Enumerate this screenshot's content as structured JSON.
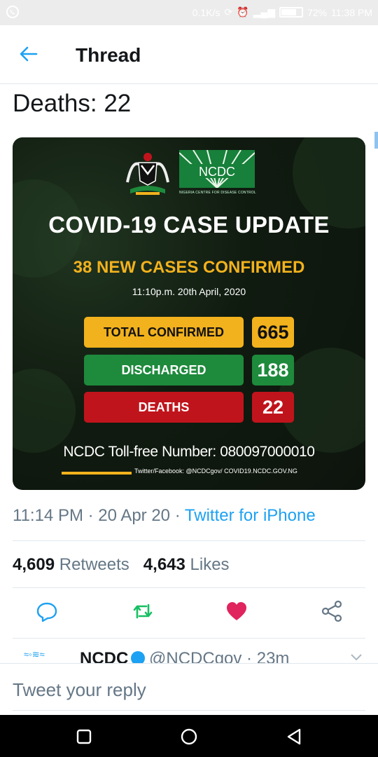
{
  "status_bar": {
    "speed": "0.1K/s",
    "battery": "72%",
    "time": "11:38 PM",
    "battery_level": 0.72
  },
  "header": {
    "title": "Thread"
  },
  "tweet": {
    "text_tail": "Deaths: 22",
    "timestamp": "11:14 PM · 20 Apr 20 · ",
    "source": "Twitter for iPhone",
    "retweets_count": "4,609",
    "retweets_label": "Retweets",
    "likes_count": "4,643",
    "likes_label": "Likes"
  },
  "media": {
    "org_name": "NCDC",
    "org_subtitle": "NIGERIA CENTRE FOR DISEASE CONTROL",
    "headline": "COVID-19 CASE UPDATE",
    "new_cases": "38 NEW CASES CONFIRMED",
    "datetime": "11:10p.m. 20th April, 2020",
    "stats": [
      {
        "label": "TOTAL CONFIRMED",
        "value": "665"
      },
      {
        "label": "DISCHARGED",
        "value": "188"
      },
      {
        "label": "DEATHS",
        "value": "22"
      }
    ],
    "tollfree": "NCDC Toll-free Number: 080097000010",
    "socials": "Twitter/Facebook: @NCDCgov/ COVID19.NCDC.GOV.NG"
  },
  "reply_preview": {
    "name": "NCDC",
    "handle": "@NCDCgov · 23m"
  },
  "reply_box": {
    "placeholder": "Tweet your reply"
  },
  "colors": {
    "accent": "#1da1f2",
    "retweet": "#17bf63",
    "like": "#e0245e",
    "yellow": "#f2b21d",
    "green": "#1e8a3c",
    "red": "#c0141c"
  }
}
